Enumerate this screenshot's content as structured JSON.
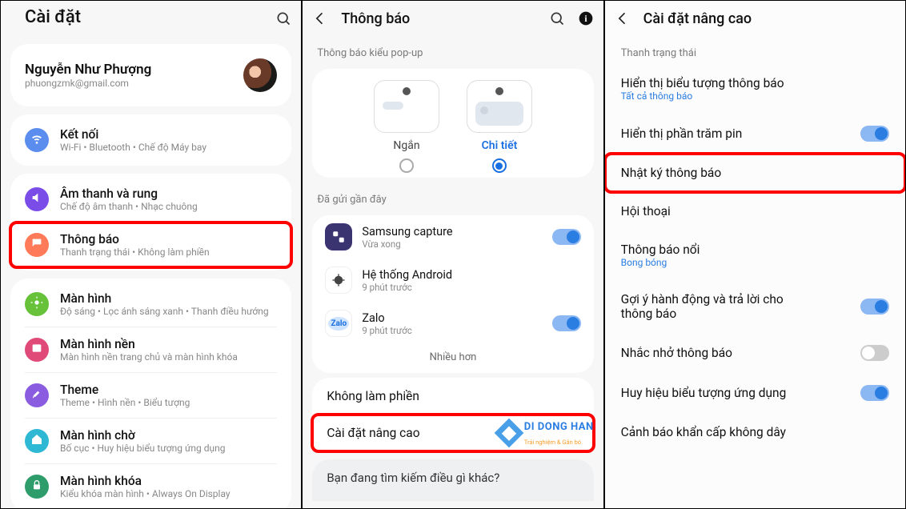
{
  "s1": {
    "title": "Cài đặt",
    "profile": {
      "name": "Nguyễn Như Phượng",
      "email": "phuongzmk@gmail.com"
    },
    "connect": {
      "t": "Kết nối",
      "s": "Wi-Fi • Bluetooth • Chế độ Máy bay"
    },
    "sound": {
      "t": "Âm thanh và rung",
      "s": "Chế độ âm thanh • Nhạc chuông"
    },
    "notif": {
      "t": "Thông báo",
      "s": "Thanh trạng thái • Không làm phiền"
    },
    "display": {
      "t": "Màn hình",
      "s": "Độ sáng • Lọc ánh sáng xanh • Thanh điều hướng"
    },
    "wall": {
      "t": "Màn hình nền",
      "s": "Màn hình nền trang chủ và màn hình khóa"
    },
    "theme": {
      "t": "Theme",
      "s": "Theme • Hình nền • Biểu tượng"
    },
    "home": {
      "t": "Màn hình chờ",
      "s": "Bố cục • Huy hiệu biểu tượng ứng dụng"
    },
    "lock": {
      "t": "Màn hình khóa",
      "s": "Kiểu khóa màn hình • Always On Display"
    }
  },
  "s2": {
    "title": "Thông báo",
    "popup_label": "Thông báo kiểu pop-up",
    "style_short": "Ngắn",
    "style_detail": "Chi tiết",
    "recent_label": "Đã gửi gần đây",
    "apps": [
      {
        "name": "Samsung capture",
        "sub": "Vừa xong",
        "on": true
      },
      {
        "name": "Hệ thống Android",
        "sub": "9 phút trước",
        "on": false
      },
      {
        "name": "Zalo",
        "sub": "9 phút trước",
        "on": true
      }
    ],
    "more": "Nhiều hơn",
    "dnd": "Không làm phiền",
    "adv": "Cài đặt nâng cao",
    "search_other": "Bạn đang tìm kiếm điều gì khác?",
    "logo_main": "DI DONG HAN",
    "logo_sub": "Trải nghiệm & Gắn bó"
  },
  "s3": {
    "title": "Cài đặt nâng cao",
    "grp": "Thanh trạng thái",
    "icons": {
      "t": "Hiển thị biểu tượng thông báo",
      "s": "Tất cả thông báo"
    },
    "battery": "Hiển thị phần trăm pin",
    "history": "Nhật ký thông báo",
    "convo": "Hội thoại",
    "float": {
      "t": "Thông báo nổi",
      "s": "Bong bóng"
    },
    "suggest": "Gợi ý hành động và trả lời cho thông báo",
    "remind": "Nhắc nhở thông báo",
    "badge": "Huy hiệu biểu tượng ứng dụng",
    "emerg": "Cảnh báo khẩn cấp không dây"
  }
}
